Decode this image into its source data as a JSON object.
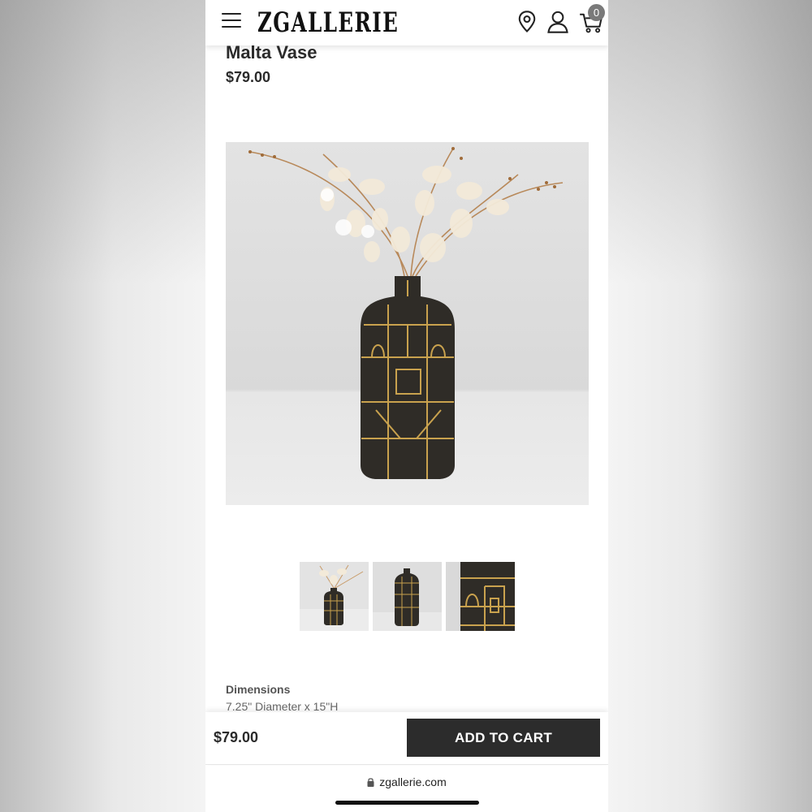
{
  "header": {
    "logo": "ZGALLERIE",
    "cart_count": "0",
    "icons": [
      "menu-icon",
      "location-pin-icon",
      "user-icon",
      "cart-icon"
    ]
  },
  "product": {
    "title": "Malta Vase",
    "price": "$79.00"
  },
  "gallery": {
    "active_index": 0,
    "thumbnail_count": 3
  },
  "details": {
    "dimensions_label": "Dimensions",
    "dimensions_value": "7.25\" Diameter x 15\"H"
  },
  "bottom_bar": {
    "price": "$79.00",
    "add_to_cart_label": "ADD TO CART"
  },
  "browser": {
    "url": "zgallerie.com"
  },
  "colors": {
    "accent": "#2c2c2c",
    "badge": "#7a7a7a"
  }
}
